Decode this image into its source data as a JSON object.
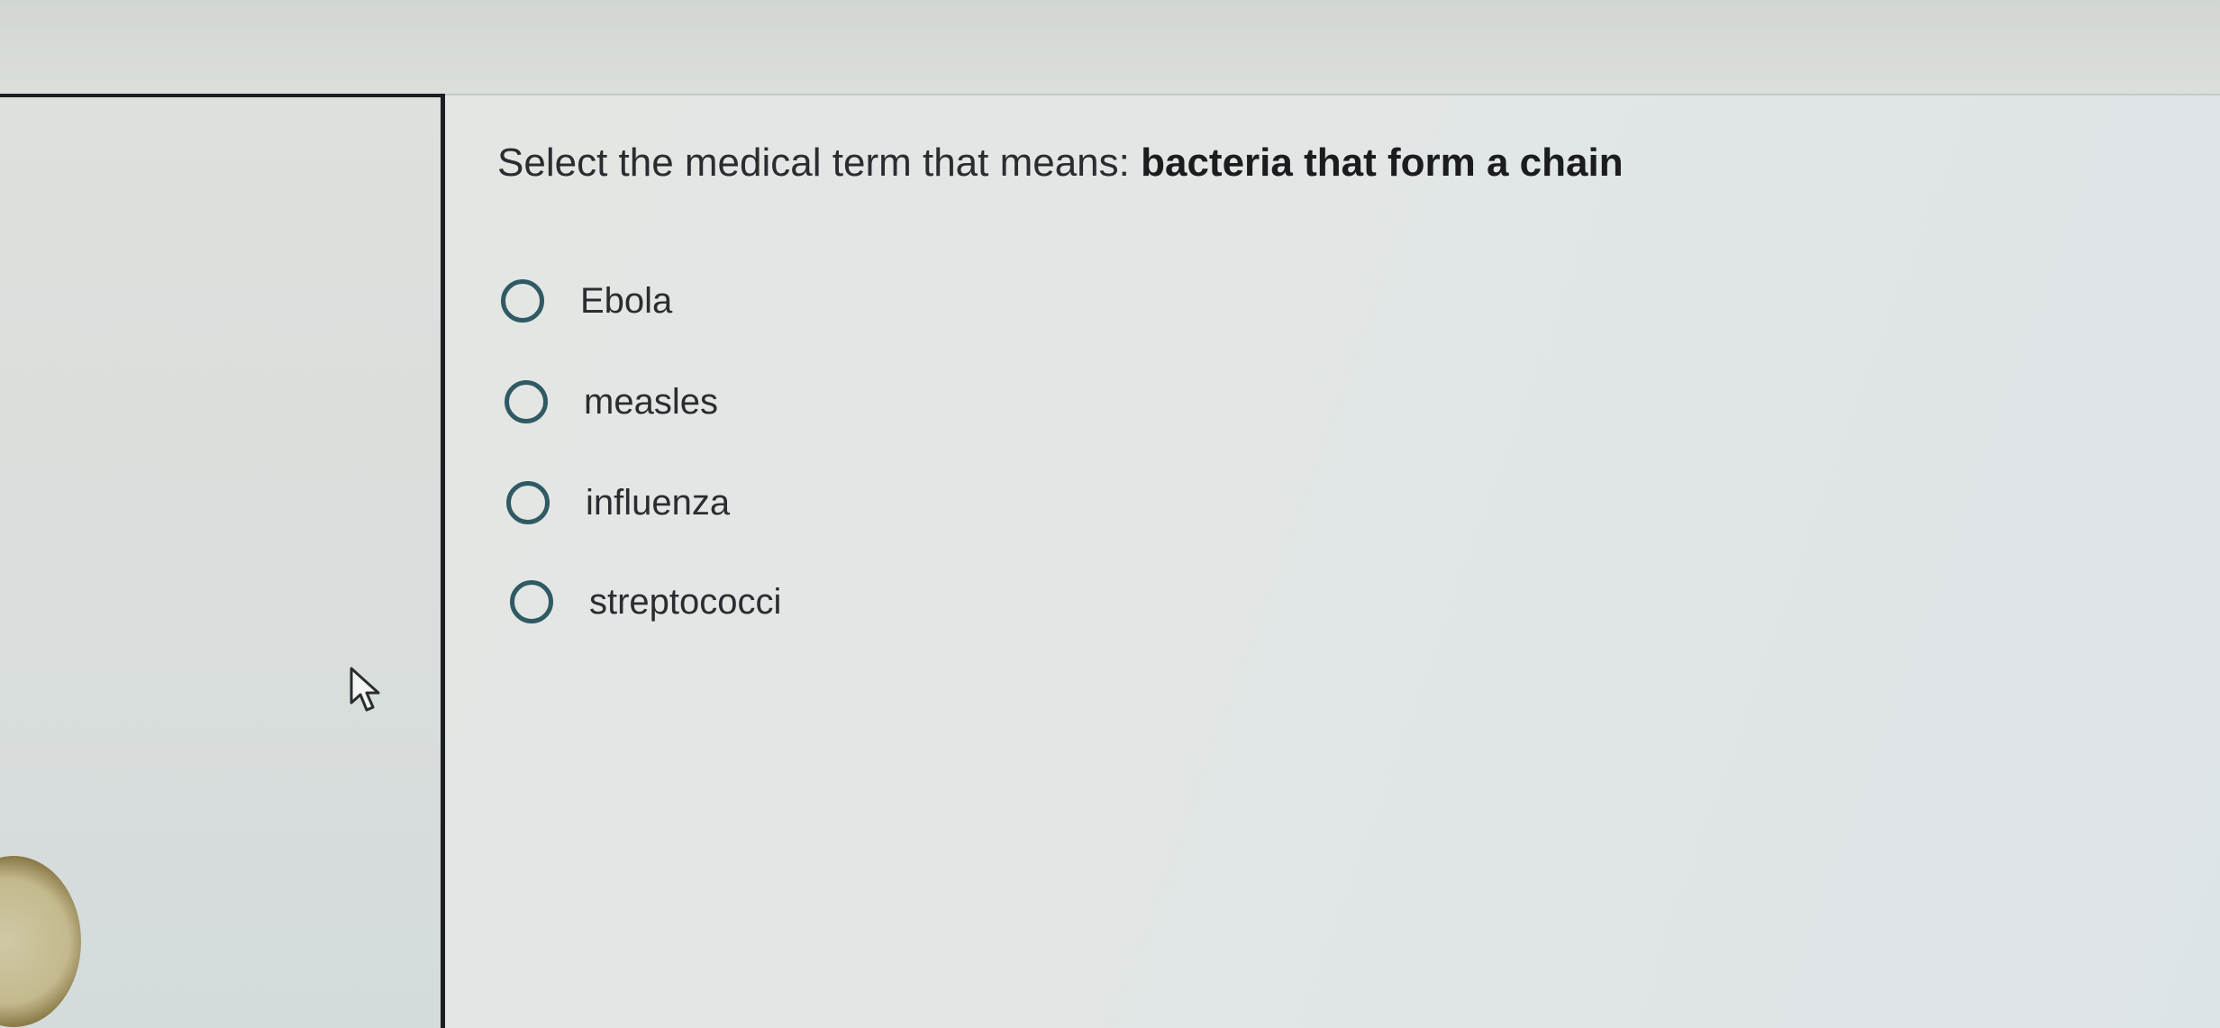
{
  "question": {
    "prefix": "Select the medical term that means: ",
    "emphasis": "bacteria that form a chain"
  },
  "options": [
    {
      "label": "Ebola",
      "selected": false
    },
    {
      "label": "measles",
      "selected": false
    },
    {
      "label": "influenza",
      "selected": false
    },
    {
      "label": "streptococci",
      "selected": false
    }
  ],
  "colors": {
    "radio_border": "#2f5a63",
    "text": "#2a2d30",
    "panel_border": "#1c1f22"
  },
  "icons": {
    "cursor": "mouse-pointer-icon"
  }
}
